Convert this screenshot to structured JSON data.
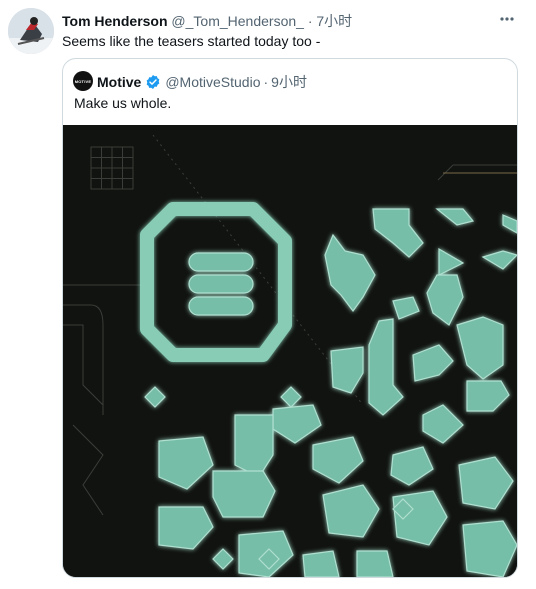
{
  "tweet": {
    "author_name": "Tom Henderson",
    "author_handle": "@_Tom_Henderson_",
    "separator": "·",
    "time": "7小时",
    "text": "Seems like the teasers started today too -",
    "avatar_icon": "avatar-photo",
    "more_icon": "more-icon"
  },
  "quote": {
    "avatar_text": "MOTIVE",
    "author_name": "Motive",
    "verified_icon": "verified-badge-icon",
    "verified_color": "#1d9bf0",
    "author_handle": "@MotiveStudio",
    "separator": "·",
    "time": "9小时",
    "text": "Make us whole."
  },
  "media": {
    "background_color": "#111310",
    "glyph_color": "#7cc8b0"
  }
}
